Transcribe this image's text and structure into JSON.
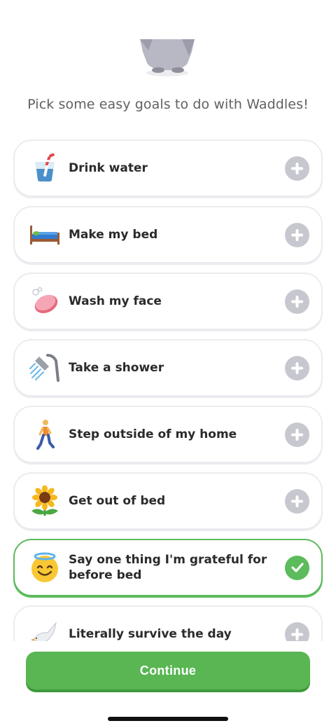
{
  "subtitle": "Pick some easy goals to do with Waddles!",
  "goals": [
    {
      "label": "Drink water",
      "icon": "cup-with-straw-icon",
      "selected": false
    },
    {
      "label": "Make my bed",
      "icon": "bed-icon",
      "selected": false
    },
    {
      "label": "Wash my face",
      "icon": "soap-icon",
      "selected": false
    },
    {
      "label": "Take a shower",
      "icon": "shower-icon",
      "selected": false
    },
    {
      "label": "Step outside of my home",
      "icon": "person-walking-icon",
      "selected": false
    },
    {
      "label": "Get out of bed",
      "icon": "sunflower-icon",
      "selected": false
    },
    {
      "label": "Say one thing I'm grateful for before bed",
      "icon": "smiling-face-with-halo-icon",
      "selected": true
    },
    {
      "label": "Literally survive the day",
      "icon": "dove-icon",
      "selected": false
    }
  ],
  "continue_label": "Continue",
  "colors": {
    "accent": "#59b653",
    "selected_border": "#5cbb5a",
    "add_button": "#c7c7d0"
  }
}
